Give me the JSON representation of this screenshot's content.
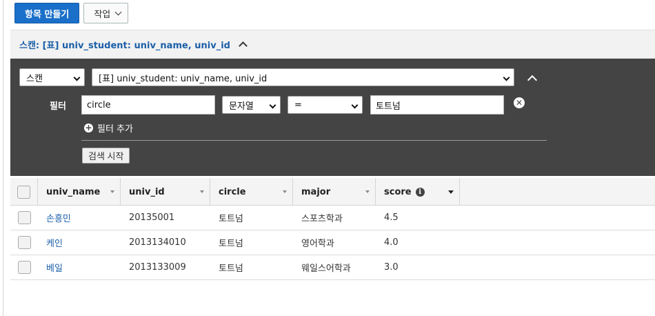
{
  "toolbar": {
    "create_item_label": "항목 만들기",
    "actions_label": "작업"
  },
  "scan_bar": {
    "title": "스캔: [표] univ_student: univ_name, univ_id"
  },
  "query_panel": {
    "mode_select": "스캔",
    "target_select": "[표] univ_student: univ_name, univ_id",
    "filter_label": "필터",
    "filter": {
      "attribute": "circle",
      "type": "문자열",
      "operator": "=",
      "value": "토트넘"
    },
    "add_filter_label": "필터 추가",
    "start_search_label": "검색 시작"
  },
  "table": {
    "columns": [
      "univ_name",
      "univ_id",
      "circle",
      "major",
      "score"
    ],
    "rows": [
      {
        "univ_name": "손흥민",
        "univ_id": "20135001",
        "circle": "토트넘",
        "major": "스포츠학과",
        "score": "4.5"
      },
      {
        "univ_name": "케인",
        "univ_id": "2013134010",
        "circle": "토트넘",
        "major": "영어학과",
        "score": "4.0"
      },
      {
        "univ_name": "베일",
        "univ_id": "2013133009",
        "circle": "토트넘",
        "major": "웨일스어학과",
        "score": "3.0"
      }
    ]
  },
  "colors": {
    "primary": "#1a6fc9",
    "link": "#1b5fa8",
    "panel_bg": "#444444"
  },
  "icons": {
    "actions_dropdown": "chevron-down-icon",
    "collapse": "chevron-up-icon",
    "remove_filter": "close-circle-icon",
    "add_filter": "plus-circle-icon",
    "score_info": "info-icon"
  }
}
